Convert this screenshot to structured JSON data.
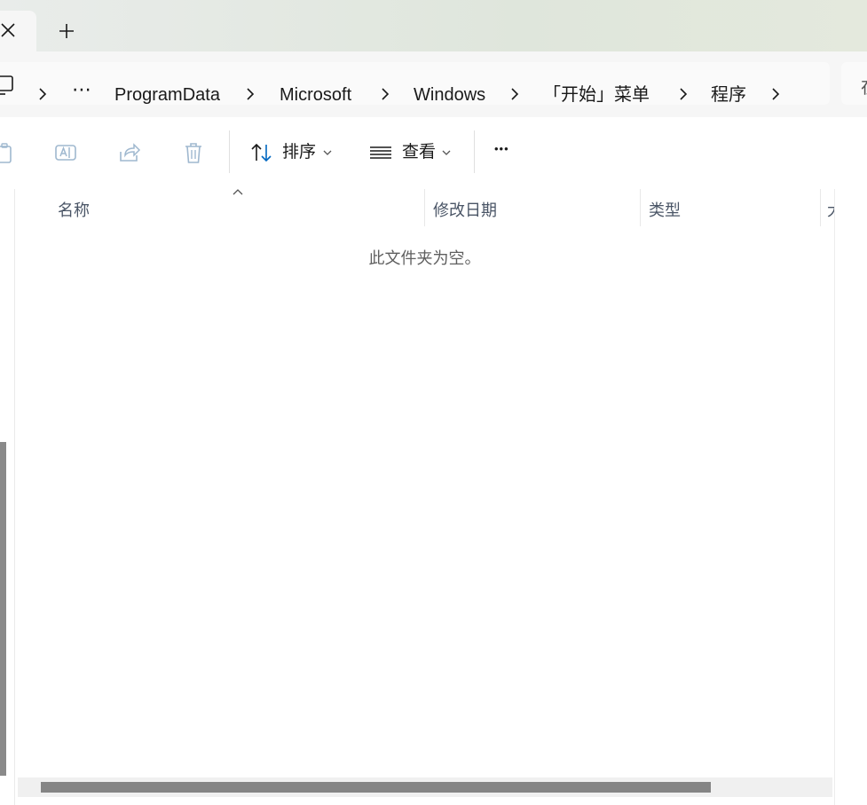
{
  "tabs": {
    "close_icon": "close-icon",
    "new_tab_icon": "plus-icon"
  },
  "breadcrumb": {
    "overflow": "⋯",
    "items": [
      "ProgramData",
      "Microsoft",
      "Windows",
      "「开始」菜单",
      "程序"
    ],
    "search_partial": "在"
  },
  "toolbar": {
    "sort_label": "排序",
    "view_label": "查看",
    "more_label": "•••"
  },
  "columns": {
    "name": "名称",
    "modified": "修改日期",
    "type": "类型",
    "size_partial": "大"
  },
  "content": {
    "empty_message": "此文件夹为空。"
  },
  "colors": {
    "accent": "#0067c0",
    "disabled_icon": "#9fb8cf",
    "scrollbar": "#858585"
  }
}
